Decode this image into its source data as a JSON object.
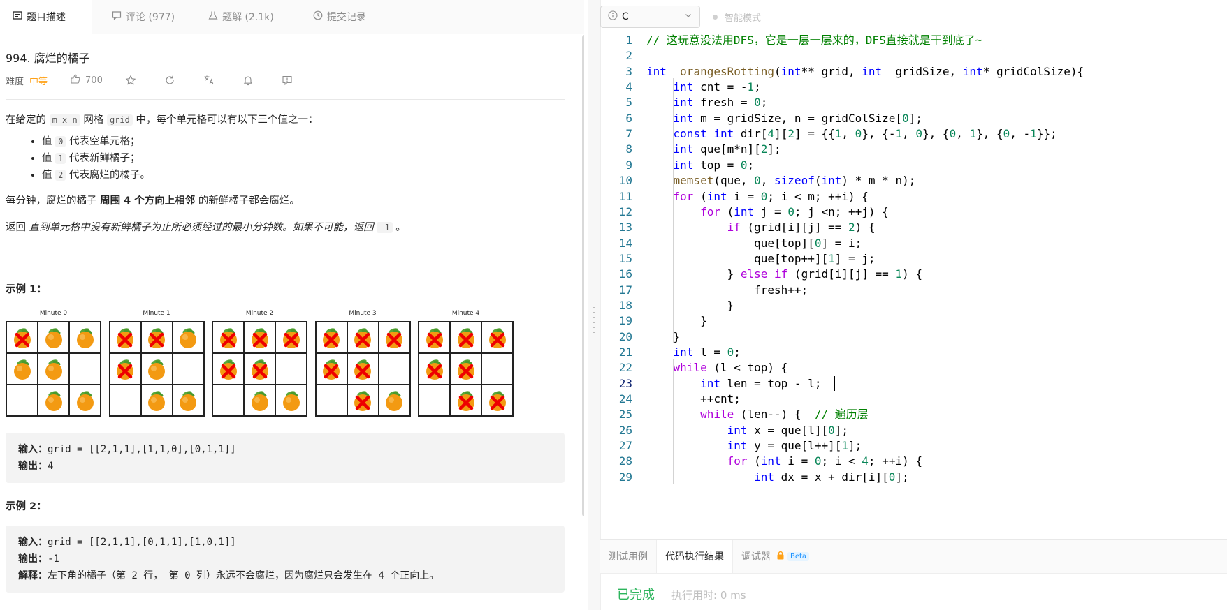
{
  "tabs": [
    {
      "label": "题目描述",
      "icon": "description-icon"
    },
    {
      "label": "评论 (977)",
      "icon": "comment-icon"
    },
    {
      "label": "题解 (2.1k)",
      "icon": "flask-icon"
    },
    {
      "label": "提交记录",
      "icon": "clock-icon"
    }
  ],
  "problem": {
    "title": "994. 腐烂的橘子",
    "difficulty_label": "难度",
    "difficulty": "中等",
    "likes": "700",
    "p1_a": "在给定的",
    "p1_code1": "m x n",
    "p1_b": "网格",
    "p1_code2": "grid",
    "p1_c": "中，每个单元格可以有以下三个值之一：",
    "bullets": [
      {
        "pre": "值",
        "code": "0",
        "post": "代表空单元格；"
      },
      {
        "pre": "值",
        "code": "1",
        "post": "代表新鲜橘子；"
      },
      {
        "pre": "值",
        "code": "2",
        "post": "代表腐烂的橘子。"
      }
    ],
    "p2_a": "每分钟，腐烂的橘子",
    "p2_b": "周围 4 个方向上相邻",
    "p2_c": "的新鲜橘子都会腐烂。",
    "p3_a": "返回",
    "p3_b": "直到单元格中没有新鲜橘子为止所必须经过的最小分钟数。如果不可能，返回",
    "p3_code": "-1",
    "p3_c": "。"
  },
  "example1": {
    "heading": "示例 1：",
    "minutes": [
      {
        "label": "Minute 0",
        "cells": [
          2,
          1,
          1,
          1,
          1,
          0,
          0,
          1,
          1
        ]
      },
      {
        "label": "Minute 1",
        "cells": [
          2,
          2,
          1,
          2,
          1,
          0,
          0,
          1,
          1
        ]
      },
      {
        "label": "Minute 2",
        "cells": [
          2,
          2,
          2,
          2,
          2,
          0,
          0,
          1,
          1
        ]
      },
      {
        "label": "Minute 3",
        "cells": [
          2,
          2,
          2,
          2,
          2,
          0,
          0,
          2,
          1
        ]
      },
      {
        "label": "Minute 4",
        "cells": [
          2,
          2,
          2,
          2,
          2,
          0,
          0,
          2,
          2
        ]
      }
    ],
    "input_label": "输入：",
    "input": "grid = [[2,1,1],[1,1,0],[0,1,1]]",
    "output_label": "输出：",
    "output": "4"
  },
  "example2": {
    "heading": "示例 2：",
    "input_label": "输入：",
    "input": "grid = [[2,1,1],[0,1,1],[1,0,1]]",
    "output_label": "输出：",
    "output": "-1",
    "explain_label": "解释：",
    "explain": "左下角的橘子（第 2 行， 第 0 列）永远不会腐烂，因为腐烂只会发生在 4 个正向上。"
  },
  "editor": {
    "language": "C",
    "smart_mode": "智能模式",
    "current_line": 23,
    "lines": [
      [
        [
          "cm",
          "// 这玩意没法用DFS，它是一层一层来的，DFS直接就是干到底了~"
        ]
      ],
      [],
      [
        [
          "kw",
          "int"
        ],
        [
          "",
          "  "
        ],
        [
          "fn",
          "orangesRotting"
        ],
        [
          "",
          "("
        ],
        [
          "kw",
          "int"
        ],
        [
          "",
          "** grid, "
        ],
        [
          "kw",
          "int"
        ],
        [
          "",
          "  gridSize, "
        ],
        [
          "kw",
          "int"
        ],
        [
          "",
          "* gridColSize){"
        ]
      ],
      [
        [
          "",
          "    "
        ],
        [
          "kw",
          "int"
        ],
        [
          "",
          " cnt = -"
        ],
        [
          "num",
          "1"
        ],
        [
          "",
          ";"
        ]
      ],
      [
        [
          "",
          "    "
        ],
        [
          "kw",
          "int"
        ],
        [
          "",
          " fresh = "
        ],
        [
          "num",
          "0"
        ],
        [
          "",
          ";"
        ]
      ],
      [
        [
          "",
          "    "
        ],
        [
          "kw",
          "int"
        ],
        [
          "",
          " m = gridSize, n = gridColSize["
        ],
        [
          "num",
          "0"
        ],
        [
          "",
          "];"
        ]
      ],
      [
        [
          "",
          "    "
        ],
        [
          "kw",
          "const"
        ],
        [
          "",
          " "
        ],
        [
          "kw",
          "int"
        ],
        [
          "",
          " dir["
        ],
        [
          "num",
          "4"
        ],
        [
          "",
          "]["
        ],
        [
          "num",
          "2"
        ],
        [
          "",
          "] = {{"
        ],
        [
          "num",
          "1"
        ],
        [
          "",
          ", "
        ],
        [
          "num",
          "0"
        ],
        [
          "",
          "}, {-"
        ],
        [
          "num",
          "1"
        ],
        [
          "",
          ", "
        ],
        [
          "num",
          "0"
        ],
        [
          "",
          "}, {"
        ],
        [
          "num",
          "0"
        ],
        [
          "",
          ", "
        ],
        [
          "num",
          "1"
        ],
        [
          "",
          "}, {"
        ],
        [
          "num",
          "0"
        ],
        [
          "",
          ", -"
        ],
        [
          "num",
          "1"
        ],
        [
          "",
          "}};"
        ]
      ],
      [
        [
          "",
          "    "
        ],
        [
          "kw",
          "int"
        ],
        [
          "",
          " que[m*n]["
        ],
        [
          "num",
          "2"
        ],
        [
          "",
          "];"
        ]
      ],
      [
        [
          "",
          "    "
        ],
        [
          "kw",
          "int"
        ],
        [
          "",
          " top = "
        ],
        [
          "num",
          "0"
        ],
        [
          "",
          ";"
        ]
      ],
      [
        [
          "",
          "    "
        ],
        [
          "fn",
          "memset"
        ],
        [
          "",
          "(que, "
        ],
        [
          "num",
          "0"
        ],
        [
          "",
          ", "
        ],
        [
          "kw",
          "sizeof"
        ],
        [
          "",
          "("
        ],
        [
          "kw",
          "int"
        ],
        [
          "",
          ") * m * n);"
        ]
      ],
      [
        [
          "",
          "    "
        ],
        [
          "ctl",
          "for"
        ],
        [
          "",
          " ("
        ],
        [
          "kw",
          "int"
        ],
        [
          "",
          " i = "
        ],
        [
          "num",
          "0"
        ],
        [
          "",
          "; i < m; ++i) {"
        ]
      ],
      [
        [
          "",
          "        "
        ],
        [
          "ctl",
          "for"
        ],
        [
          "",
          " ("
        ],
        [
          "kw",
          "int"
        ],
        [
          "",
          " j = "
        ],
        [
          "num",
          "0"
        ],
        [
          "",
          "; j <n; ++j) {"
        ]
      ],
      [
        [
          "",
          "            "
        ],
        [
          "ctl",
          "if"
        ],
        [
          "",
          " (grid[i][j] == "
        ],
        [
          "num",
          "2"
        ],
        [
          "",
          ") {"
        ]
      ],
      [
        [
          "",
          "                que[top]["
        ],
        [
          "num",
          "0"
        ],
        [
          "",
          "] = i;"
        ]
      ],
      [
        [
          "",
          "                que[top++]["
        ],
        [
          "num",
          "1"
        ],
        [
          "",
          "] = j;"
        ]
      ],
      [
        [
          "",
          "            } "
        ],
        [
          "ctl",
          "else if"
        ],
        [
          "",
          " (grid[i][j] == "
        ],
        [
          "num",
          "1"
        ],
        [
          "",
          ") {"
        ]
      ],
      [
        [
          "",
          "                fresh++;"
        ]
      ],
      [
        [
          "",
          "            }"
        ]
      ],
      [
        [
          "",
          "        }"
        ]
      ],
      [
        [
          "",
          "    }"
        ]
      ],
      [
        [
          "",
          "    "
        ],
        [
          "kw",
          "int"
        ],
        [
          "",
          " l = "
        ],
        [
          "num",
          "0"
        ],
        [
          "",
          ";"
        ]
      ],
      [
        [
          "",
          "    "
        ],
        [
          "ctl",
          "while"
        ],
        [
          "",
          " (l < top) {"
        ]
      ],
      [
        [
          "",
          "        "
        ],
        [
          "kw",
          "int"
        ],
        [
          "",
          " len = top - l;"
        ]
      ],
      [
        [
          "",
          "        ++cnt;"
        ]
      ],
      [
        [
          "",
          "        "
        ],
        [
          "ctl",
          "while"
        ],
        [
          "",
          " (len--) {  "
        ],
        [
          "cm",
          "// 遍历层"
        ]
      ],
      [
        [
          "",
          "            "
        ],
        [
          "kw",
          "int"
        ],
        [
          "",
          " x = que[l]["
        ],
        [
          "num",
          "0"
        ],
        [
          "",
          "];"
        ]
      ],
      [
        [
          "",
          "            "
        ],
        [
          "kw",
          "int"
        ],
        [
          "",
          " y = que[l++]["
        ],
        [
          "num",
          "1"
        ],
        [
          "",
          "];"
        ]
      ],
      [
        [
          "",
          "            "
        ],
        [
          "ctl",
          "for"
        ],
        [
          "",
          " ("
        ],
        [
          "kw",
          "int"
        ],
        [
          "",
          " i = "
        ],
        [
          "num",
          "0"
        ],
        [
          "",
          "; i < "
        ],
        [
          "num",
          "4"
        ],
        [
          "",
          "; ++i) {"
        ]
      ],
      [
        [
          "",
          "                "
        ],
        [
          "kw",
          "int"
        ],
        [
          "",
          " dx = x + dir[i]["
        ],
        [
          "num",
          "0"
        ],
        [
          "",
          "];"
        ]
      ]
    ]
  },
  "bottom": {
    "tabs": [
      "测试用例",
      "代码执行结果",
      "调试器"
    ],
    "beta": "Beta",
    "status": "已完成",
    "time_label": "执行用时: 0 ms"
  },
  "colors": {
    "accent": "#ffa116",
    "success": "#2db55d"
  }
}
